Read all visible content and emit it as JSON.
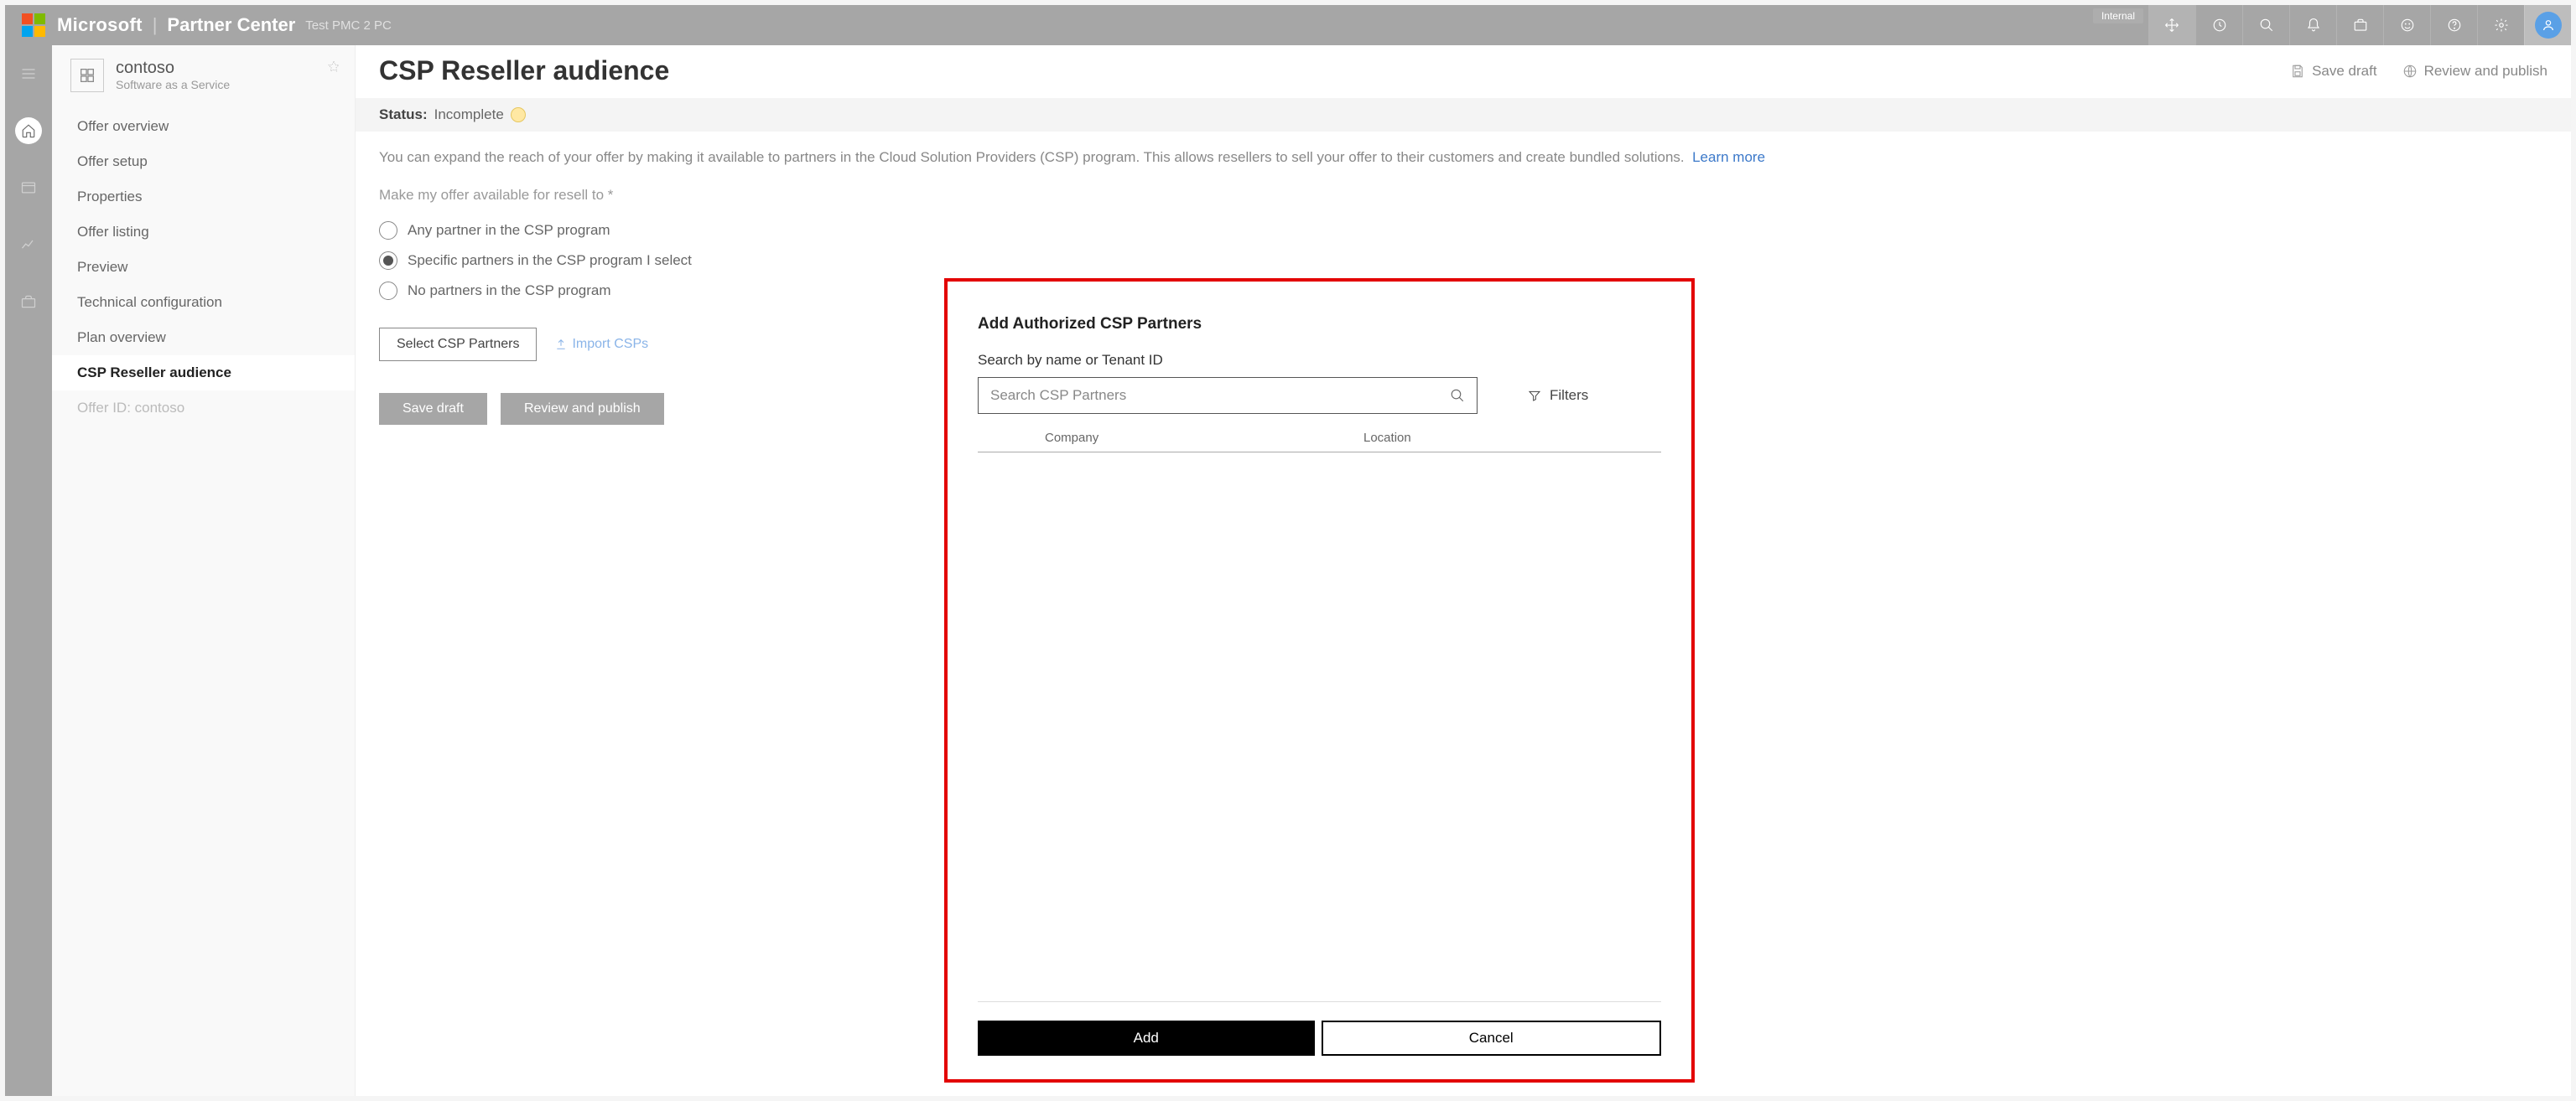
{
  "header": {
    "brand": "Microsoft",
    "app": "Partner Center",
    "sub": "Test PMC 2 PC",
    "pill": "Internal",
    "icons": {
      "move": "move-icon",
      "clock": "clock-icon",
      "search": "search-icon",
      "bell": "bell-icon",
      "lock": "lock-icon",
      "face": "face-icon",
      "help": "help-icon",
      "gear": "gear-icon"
    }
  },
  "rail": {
    "items": [
      "menu",
      "home",
      "card",
      "chart",
      "briefcase"
    ]
  },
  "sidebar": {
    "title": "contoso",
    "subtitle": "Software as a Service",
    "items": [
      {
        "label": "Offer overview"
      },
      {
        "label": "Offer setup"
      },
      {
        "label": "Properties"
      },
      {
        "label": "Offer listing"
      },
      {
        "label": "Preview"
      },
      {
        "label": "Technical configuration"
      },
      {
        "label": "Plan overview"
      },
      {
        "label": "CSP Reseller audience"
      },
      {
        "label": "Offer ID: contoso"
      }
    ],
    "activeIndex": 7,
    "mutedIndex": 8
  },
  "main": {
    "title": "CSP Reseller audience",
    "actions": {
      "save_draft": "Save draft",
      "review_publish": "Review and publish"
    },
    "status": {
      "label": "Status:",
      "value": "Incomplete"
    },
    "description": "You can expand the reach of your offer by making it available to partners in the Cloud Solution Providers (CSP) program. This allows resellers to sell your offer to their customers and create bundled solutions.",
    "learn_more": "Learn more",
    "field_label": "Make my offer available for resell to *",
    "radios": [
      {
        "label": "Any partner in the CSP program"
      },
      {
        "label": "Specific partners in the CSP program I select"
      },
      {
        "label": "No partners in the CSP program"
      }
    ],
    "radio_selected": 1,
    "select_btn": "Select CSP Partners",
    "import_link": "Import CSPs",
    "footer": {
      "save_draft": "Save draft",
      "review_publish": "Review and publish"
    }
  },
  "panel": {
    "title": "Add Authorized CSP Partners",
    "search_label": "Search by name or Tenant ID",
    "search_placeholder": "Search CSP Partners",
    "filters": "Filters",
    "columns": {
      "company": "Company",
      "location": "Location"
    },
    "add": "Add",
    "cancel": "Cancel"
  }
}
